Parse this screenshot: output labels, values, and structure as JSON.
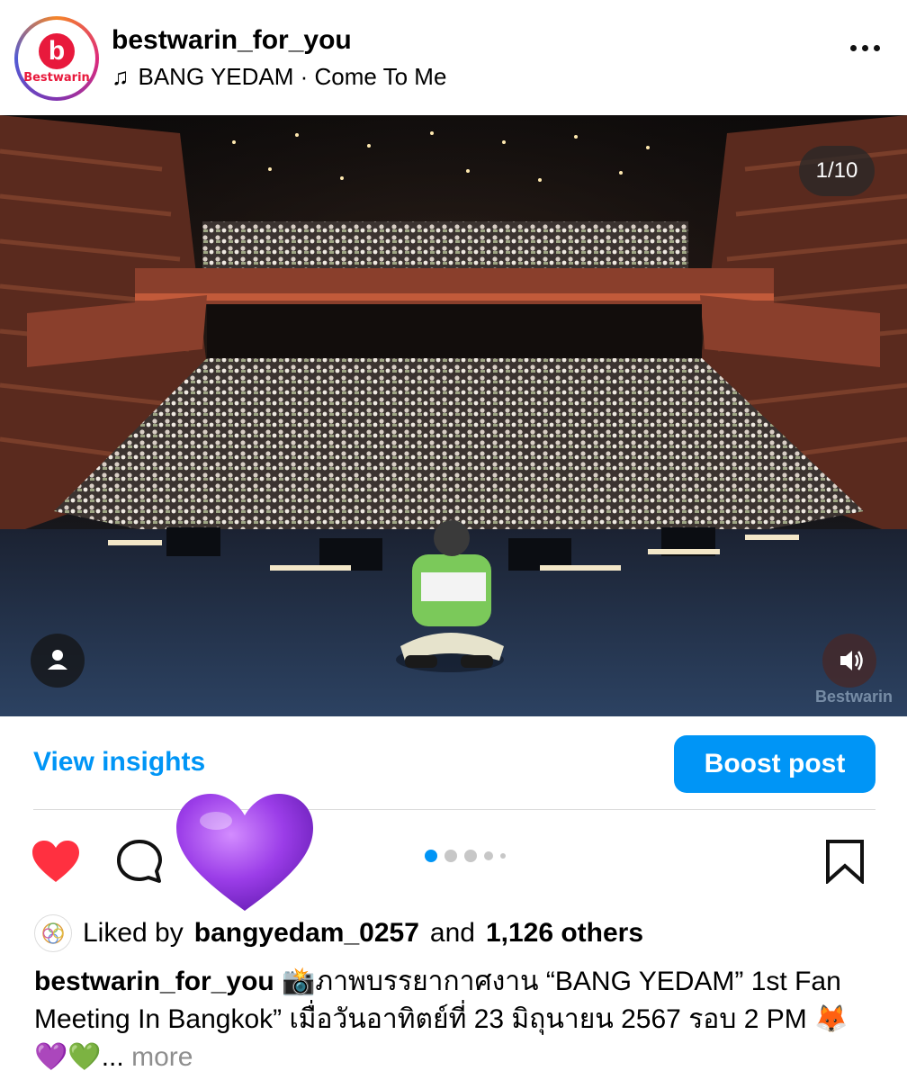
{
  "post": {
    "username": "bestwarin_for_you",
    "avatar_brand": "Bestwarin",
    "avatar_letter": "b",
    "music_icon": "music-note-icon",
    "music": "BANG YEDAM · Come To Me",
    "more_icon": "more-horizontal-icon"
  },
  "media": {
    "counter": "1/10",
    "watermark": "Bestwarin",
    "user_tag_icon": "person-icon",
    "sound_icon": "speaker-icon",
    "carousel_dots": 5,
    "active_dot": 0
  },
  "actions": {
    "view_insights": "View insights",
    "boost_post": "Boost post",
    "like_icon": "heart-filled-icon",
    "comment_icon": "comment-icon",
    "reaction_icon": "purple-heart-icon",
    "save_icon": "bookmark-icon"
  },
  "likes": {
    "prefix": "Liked by",
    "user": "bangyedam_0257",
    "and": "and",
    "others": "1,126 others"
  },
  "caption": {
    "username": "bestwarin_for_you",
    "text": " 📸ภาพบรรยากาศงาน “BANG YEDAM” 1st Fan Meeting In Bangkok” เมื่อวันอาทิตย์ที่ 23 มิถุนายน 2567 รอบ 2 PM 🦊💜💚",
    "ellipsis": "...",
    "more": "more"
  },
  "colors": {
    "accent": "#0095f6",
    "like_red": "#ff3040",
    "purple_heart": "#9b3de8"
  }
}
